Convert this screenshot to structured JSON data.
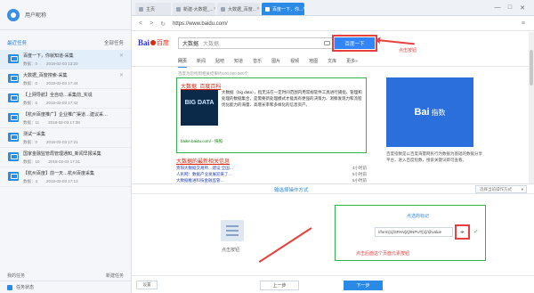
{
  "sidebar": {
    "username": "用户昵称",
    "tasks_label": "最近任务",
    "tasks_right": "全部任务",
    "tasks": [
      {
        "name": "百度一下，你就知道-采集",
        "count": "数据：0",
        "date": "2018-02-03 13:20",
        "active": true,
        "closable": true
      },
      {
        "name": "大数据_百度搜索-采集",
        "count": "数据：0",
        "date": "2018-02-03 17:44",
        "active": false,
        "closable": true
      },
      {
        "name": "【上网导航】全自动…采集前_实说",
        "count": "数据：0",
        "date": "2018-02-03 17:42",
        "active": false,
        "closable": false
      },
      {
        "name": "【杭州百度推广】企业推广渠道…建议采…",
        "count": "数据：11",
        "date": "2018-02-03 17:38",
        "active": false,
        "closable": false
      },
      {
        "name": "测试一采集",
        "count": "数据：0",
        "date": "2018-02-03 17:21",
        "active": false,
        "closable": false
      },
      {
        "name": "国家金融监管局管理通知_新闻早报采集",
        "count": "数据：10",
        "date": "2018-02-03 17:31",
        "active": false,
        "closable": false
      },
      {
        "name": "【杭州百度】前一天…杭州百度采集",
        "count": "数据：4",
        "date": "2018-02-03 17:13",
        "active": false,
        "closable": false
      }
    ],
    "footer_left": "我的任务",
    "footer_right": "新建任务",
    "footer_bottom": "任务状态"
  },
  "tabs": [
    {
      "label": "主页",
      "active": false,
      "closable": false
    },
    {
      "label": "新建-大数据_...",
      "active": false,
      "closable": true
    },
    {
      "label": "大数据_百度...",
      "active": false,
      "closable": true
    },
    {
      "label": "百度一下，你...",
      "active": true,
      "closable": true
    }
  ],
  "window_controls": [
    "—",
    "□",
    "✕"
  ],
  "address": {
    "back": "<",
    "forward": ">",
    "refresh": "↻",
    "url": "https://www.baidu.com/",
    "menu": "≡"
  },
  "baidu": {
    "logo_left": "Bai",
    "logo_right": "百度",
    "query": "大数据",
    "placeholder": "大数据",
    "button": "百度一下",
    "annotation": "点击按钮",
    "search_tabs": [
      "网页",
      "新闻",
      "贴吧",
      "知道",
      "音乐",
      "图片",
      "视频",
      "地图",
      "文库",
      "更多»"
    ],
    "result_count": "百度为您找到相关结果约100,000,000个",
    "result1_title": "大数据_百度百科",
    "bigdata_img": "BIG DATA",
    "result1_body": "大数据（big data），指无法在一定时间范围内用常规软件工具进行捕捉、管理和处理的数据集合，是需要新处理模式才能具有更强的决策力、洞察发现力和流程优化能力的海量、高增长率和多样化的信息资产。",
    "result1_url": "baike.baidu.com/  - 快照",
    "result2_title": "大数据的最新相关信息",
    "result2_rows": [
      {
        "text": "贵阳大数据交易所…建设 全国…",
        "time": "4小时前"
      },
      {
        "text": "人民网：数据产业发展迎来了…",
        "time": "5小时前"
      },
      {
        "text": "大数据推进科技金融监管…",
        "time": "5小时前"
      },
      {
        "text": "数字经济…大数据产业…",
        "time": "6小时前"
      }
    ],
    "right_logo": "Bai",
    "right_logo_sub": "指数",
    "right_desc": "百度指数是以百度海量网民行为数据为基础的数据分享平台，进入百度指数，搜索关键词即可查看。"
  },
  "bottom": {
    "title": "输选择操作方式",
    "select": "选择当前操作方式",
    "click_label": "点击按钮",
    "xpath_title": "点选的标记",
    "xpath_value": "//form[1]/SPAN[2]/INPUT[1]/@value",
    "target_icon": "⌖",
    "check_icon": "✓",
    "annotation": "点击后面这个页面元素按钮",
    "settings": "设置",
    "prev": "上一步",
    "next": "下一步"
  }
}
